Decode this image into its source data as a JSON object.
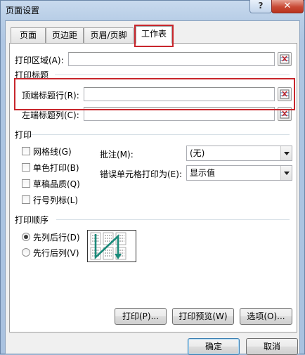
{
  "window": {
    "title": "页面设置",
    "help_label": "?",
    "close_label": "✕"
  },
  "tabs": [
    {
      "label": "页面",
      "active": false
    },
    {
      "label": "页边距",
      "active": false
    },
    {
      "label": "页眉/页脚",
      "active": false
    },
    {
      "label": "工作表",
      "active": true
    }
  ],
  "sheet": {
    "print_area_label": "打印区域(A):",
    "print_area_value": "",
    "print_titles_group": "打印标题",
    "rows_to_repeat_label": "顶端标题行(R):",
    "rows_to_repeat_value": "",
    "cols_to_repeat_label": "左端标题列(C):",
    "cols_to_repeat_value": "",
    "print_group": "打印",
    "checkboxes": [
      {
        "label": "网格线(G)",
        "checked": false
      },
      {
        "label": "单色打印(B)",
        "checked": false
      },
      {
        "label": "草稿品质(Q)",
        "checked": false
      },
      {
        "label": "行号列标(L)",
        "checked": false
      }
    ],
    "comments_label": "批注(M):",
    "comments_value": "(无)",
    "cell_errors_label": "错误单元格打印为(E):",
    "cell_errors_value": "显示值",
    "page_order_group": "打印顺序",
    "page_order_options": [
      {
        "label": "先列后行(D)",
        "selected": true
      },
      {
        "label": "先行后列(V)",
        "selected": false
      }
    ]
  },
  "buttons": {
    "print": "打印(P)...",
    "print_preview": "打印预览(W)",
    "options": "选项(O)...",
    "ok": "确定",
    "cancel": "取消"
  },
  "colors": {
    "highlight_box": "#c8262c",
    "order_arrow": "#1a8a7a"
  },
  "icons": {
    "range_picker": "collapse-dialog-icon",
    "page_order": "page-order-down-then-over-icon"
  }
}
